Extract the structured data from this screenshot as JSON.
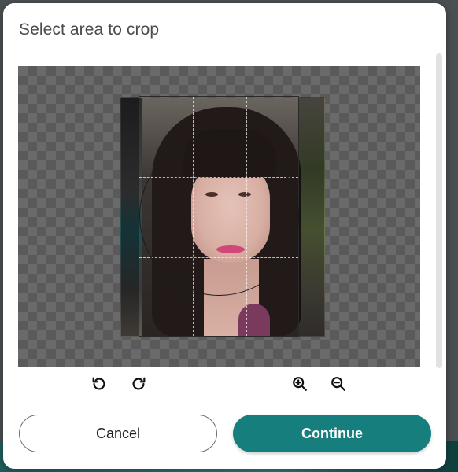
{
  "dialog": {
    "title": "Select area to crop"
  },
  "toolbar": {
    "rotate_left_icon": "rotate-left-icon",
    "rotate_right_icon": "rotate-right-icon",
    "zoom_in_icon": "zoom-in-icon",
    "zoom_out_icon": "zoom-out-icon"
  },
  "buttons": {
    "cancel_label": "Cancel",
    "continue_label": "Continue"
  },
  "colors": {
    "accent": "#167e7d",
    "text": "#4b4b4b"
  }
}
